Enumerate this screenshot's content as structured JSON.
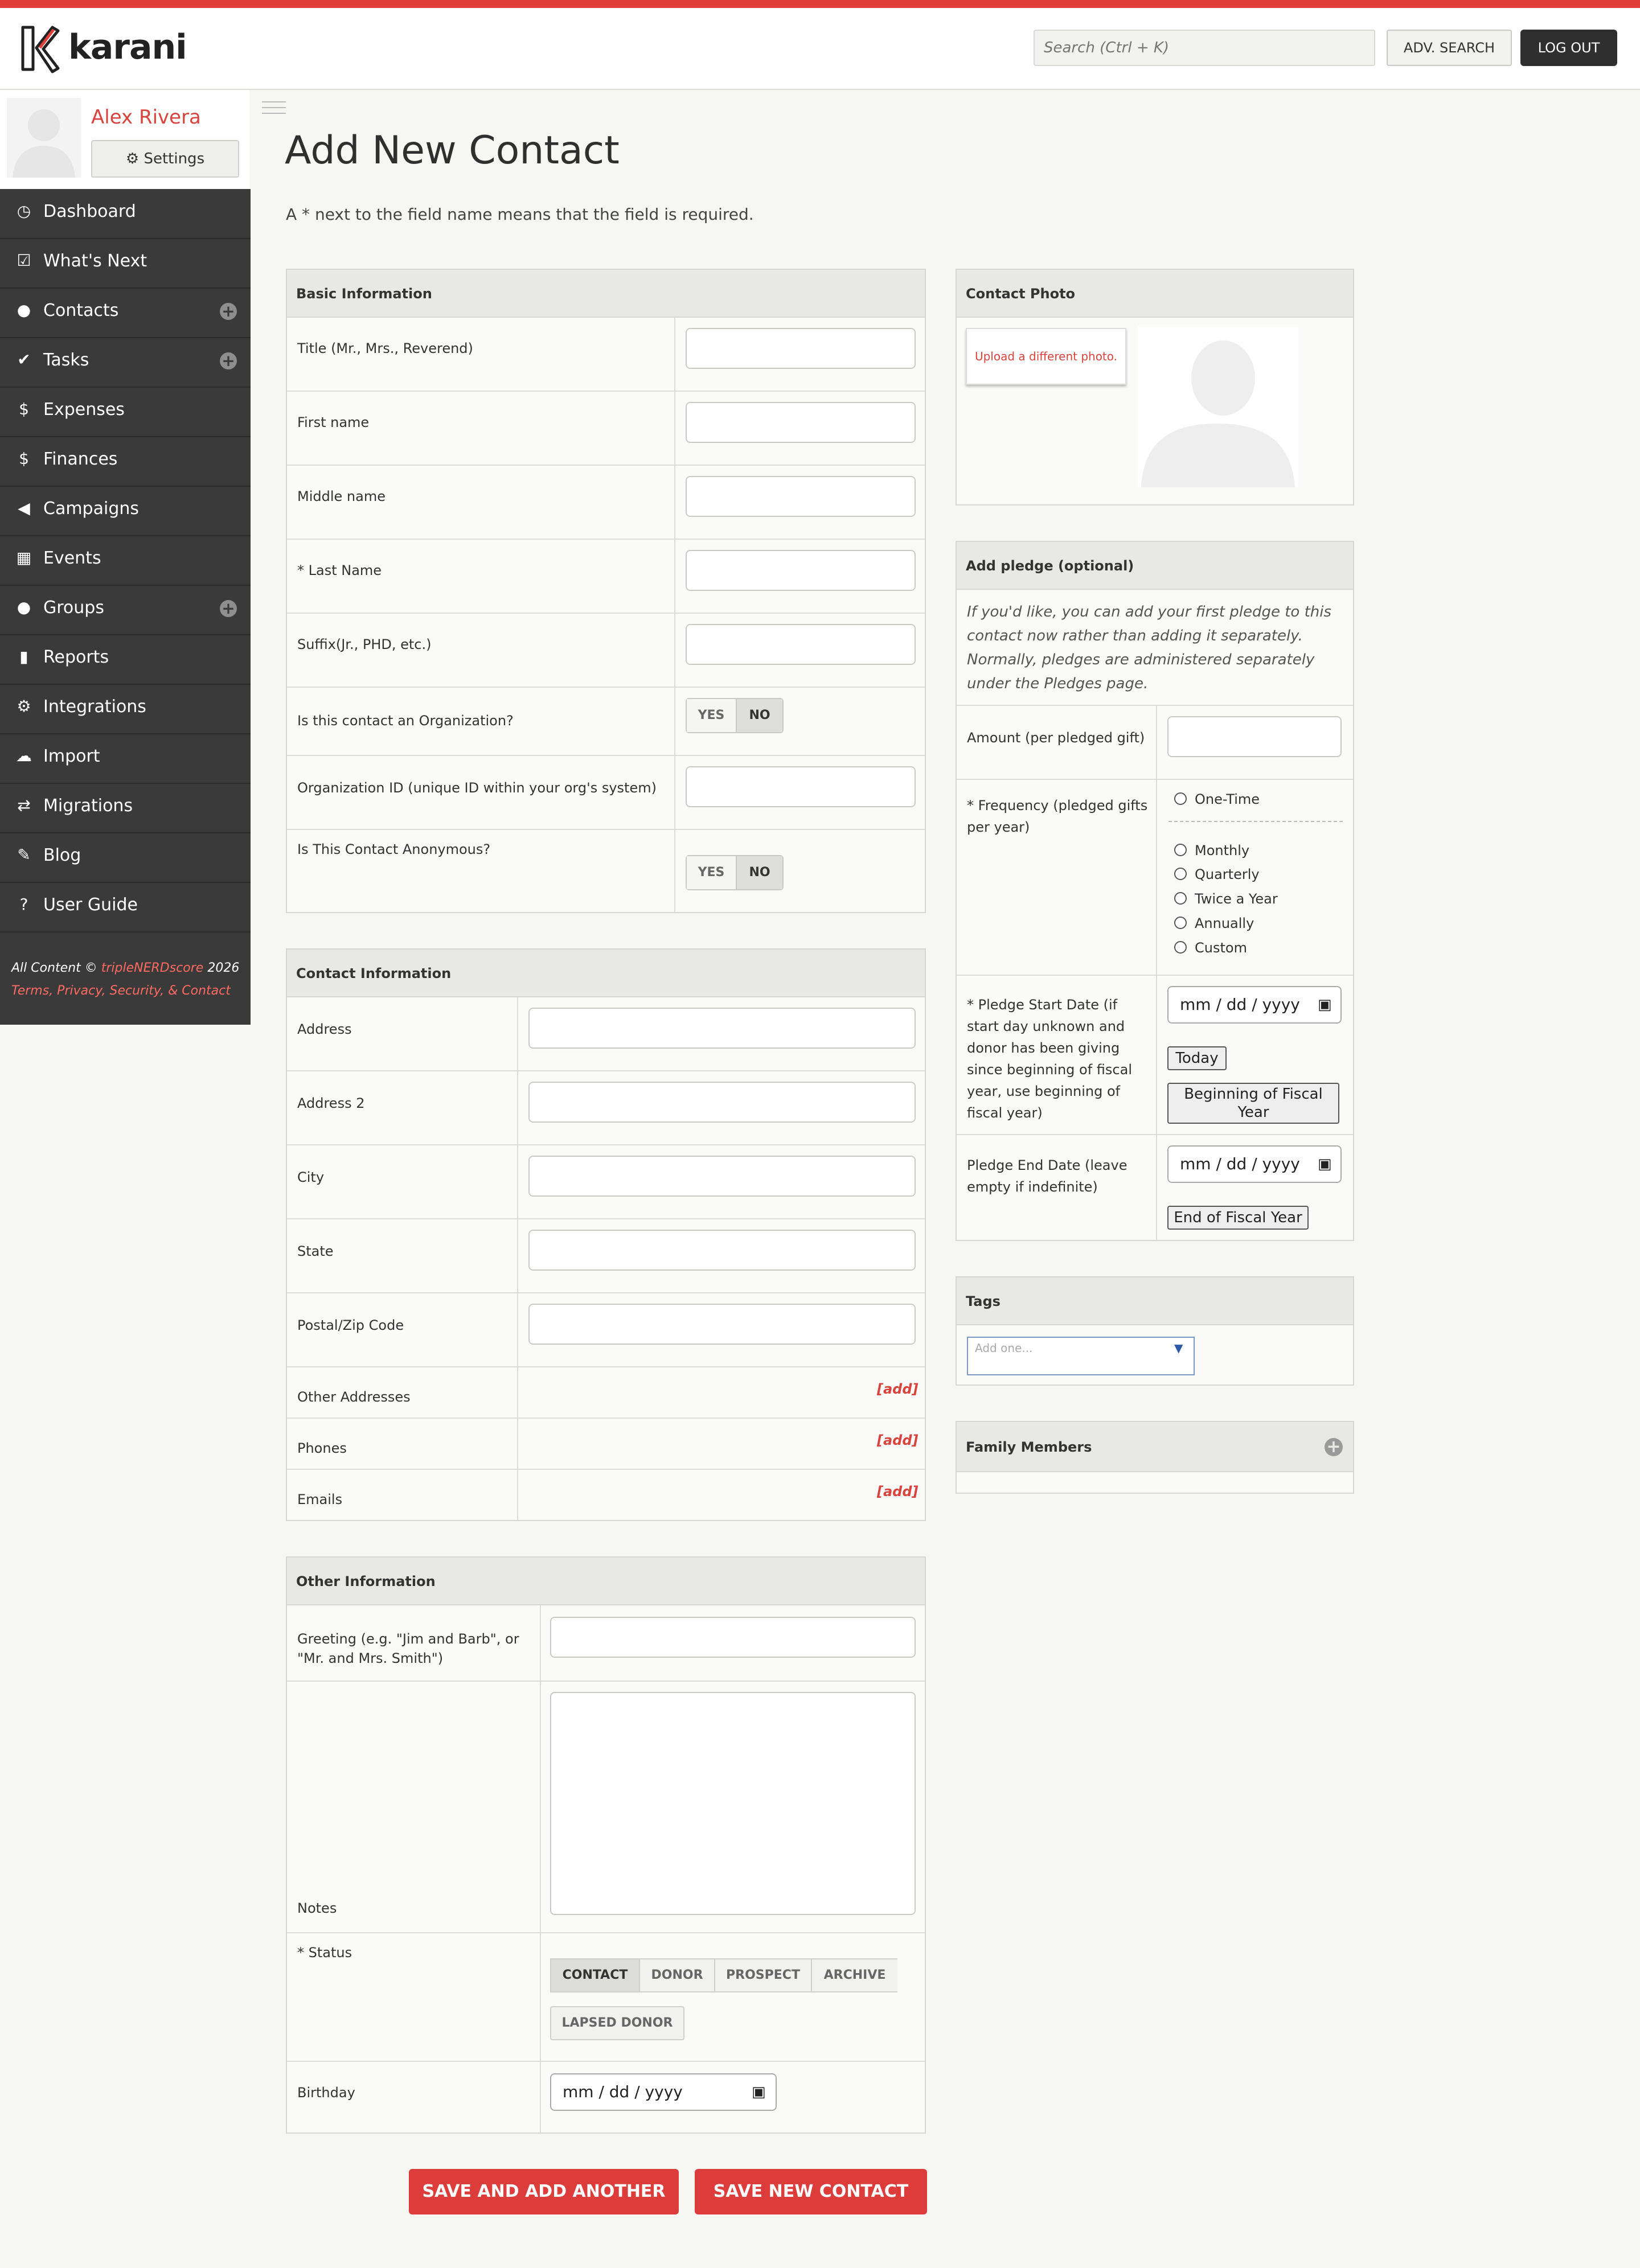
{
  "app": {
    "name": "karani",
    "brand_color": "#e03c38",
    "sidebar_bg": "#3a3a3a"
  },
  "header": {
    "search_placeholder": "Search (Ctrl + K)",
    "adv_search_label": "ADV. SEARCH",
    "logout_label": "LOG OUT"
  },
  "profile": {
    "name": "Alex Rivera",
    "settings_label": "Settings"
  },
  "sidebar": {
    "items": [
      {
        "label": "Dashboard",
        "icon": "dashboard-icon",
        "glyph": "◷",
        "plus": false
      },
      {
        "label": "What's Next",
        "icon": "check-square-icon",
        "glyph": "☑",
        "plus": false
      },
      {
        "label": "Contacts",
        "icon": "user-icon",
        "glyph": "●",
        "plus": true
      },
      {
        "label": "Tasks",
        "icon": "check-icon",
        "glyph": "✔",
        "plus": true
      },
      {
        "label": "Expenses",
        "icon": "dollar-icon",
        "glyph": "$",
        "plus": false
      },
      {
        "label": "Finances",
        "icon": "dollar-icon",
        "glyph": "$",
        "plus": false
      },
      {
        "label": "Campaigns",
        "icon": "megaphone-icon",
        "glyph": "◀",
        "plus": false
      },
      {
        "label": "Events",
        "icon": "calendar-icon",
        "glyph": "▦",
        "plus": false
      },
      {
        "label": "Groups",
        "icon": "group-icon",
        "glyph": "●",
        "plus": true
      },
      {
        "label": "Reports",
        "icon": "bar-chart-icon",
        "glyph": "▮",
        "plus": false
      },
      {
        "label": "Integrations",
        "icon": "gear-icon",
        "glyph": "⚙",
        "plus": false
      },
      {
        "label": "Import",
        "icon": "cloud-upload-icon",
        "glyph": "☁",
        "plus": false
      },
      {
        "label": "Migrations",
        "icon": "exchange-icon",
        "glyph": "⇄",
        "plus": false
      },
      {
        "label": "Blog",
        "icon": "pencil-icon",
        "glyph": "✎",
        "plus": false
      },
      {
        "label": "User Guide",
        "icon": "question-icon",
        "glyph": "?",
        "plus": false
      }
    ],
    "footer_prefix": "All Content © ",
    "footer_link": "tripleNERDscore",
    "footer_year": " 2026",
    "footer_links_line": "Terms, Privacy, Security, & Contact"
  },
  "page": {
    "title": "Add New Contact",
    "required_note": "A * next to the field name means that the field is required."
  },
  "basic": {
    "heading": "Basic Information",
    "fields": {
      "title": "Title (Mr., Mrs., Reverend)",
      "first": "First name",
      "middle": "Middle name",
      "last": "* Last Name",
      "suffix": "Suffix(Jr., PHD, etc.)",
      "is_org": "Is this contact an Organization?",
      "org_id": "Organization ID (unique ID within your org's system)",
      "anon": "Is This Contact Anonymous?"
    },
    "yes": "YES",
    "no": "NO"
  },
  "contact_info": {
    "heading": "Contact Information",
    "address": "Address",
    "address2": "Address 2",
    "city": "City",
    "state": "State",
    "zip": "Postal/Zip Code",
    "other_addresses": "Other Addresses",
    "phones": "Phones",
    "emails": "Emails",
    "add": "[add]"
  },
  "other_info": {
    "heading": "Other Information",
    "greeting_line1": "Greeting (e.g. \"Jim and Barb\", or",
    "greeting_line2": "\"Mr. and Mrs. Smith\")",
    "notes": "Notes",
    "status": "* Status",
    "status_options": [
      "CONTACT",
      "DONOR",
      "PROSPECT",
      "ARCHIVE",
      "LAPSED DONOR"
    ],
    "birthday": "Birthday",
    "date_placeholder": "mm / dd / yyyy"
  },
  "photo": {
    "heading": "Contact Photo",
    "upload_label": "Upload a different photo."
  },
  "pledge": {
    "heading": "Add pledge (optional)",
    "intro_l1": "If you'd like, you can add your first pledge to this",
    "intro_l2": "contact now rather than adding it separately.",
    "intro_l3": "Normally, pledges are administered separately",
    "intro_l4": "under the Pledges page.",
    "amount": "Amount (per pledged gift)",
    "freq_l1": "* Frequency (pledged gifts",
    "freq_l2": "per year)",
    "freq_options": [
      "One-Time",
      "Monthly",
      "Quarterly",
      "Twice a Year",
      "Annually",
      "Custom"
    ],
    "start_l1": "* Pledge Start Date (if",
    "start_l2": "start day unknown and",
    "start_l3": "donor has been giving",
    "start_l4": "since beginning of fiscal",
    "start_l5": "year, use beginning of",
    "start_l6": "fiscal year)",
    "today": "Today",
    "bofy_l1": "Beginning of Fiscal",
    "bofy_l2": "Year",
    "end_l1": "Pledge End Date (leave",
    "end_l2": "empty if indefinite)",
    "eofy": "End of Fiscal Year",
    "date_placeholder": "mm / dd / yyyy"
  },
  "tags": {
    "heading": "Tags",
    "placeholder": "Add one..."
  },
  "family": {
    "heading": "Family Members"
  },
  "actions": {
    "save_add_another": "SAVE AND ADD ANOTHER",
    "save_new": "SAVE NEW CONTACT"
  }
}
